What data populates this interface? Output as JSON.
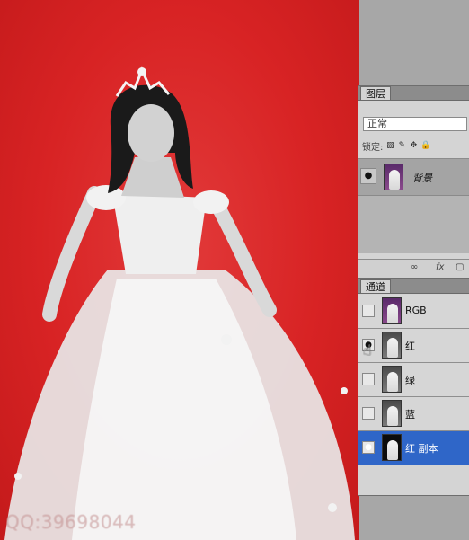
{
  "watermark": "QQ:39698044",
  "layers_panel": {
    "tab_label": "图层",
    "blend_mode": "正常",
    "lock_label": "锁定:",
    "layers": [
      {
        "name": "背景",
        "visible": true
      }
    ],
    "footer_icons": [
      "link-icon",
      "fx-icon",
      "mask-icon"
    ],
    "footer_fx_label": "fx"
  },
  "channels_panel": {
    "tab_label": "通道",
    "channels": [
      {
        "name": "RGB",
        "visible": false,
        "selected": false
      },
      {
        "name": "红",
        "visible": true,
        "selected": false
      },
      {
        "name": "绿",
        "visible": false,
        "selected": false
      },
      {
        "name": "蓝",
        "visible": false,
        "selected": false
      },
      {
        "name": "红 副本",
        "visible": true,
        "selected": true
      }
    ]
  },
  "colors": {
    "canvas_red": "#d82324",
    "selection_blue": "#2f66c8",
    "panel_bg": "#d4d4d4"
  }
}
